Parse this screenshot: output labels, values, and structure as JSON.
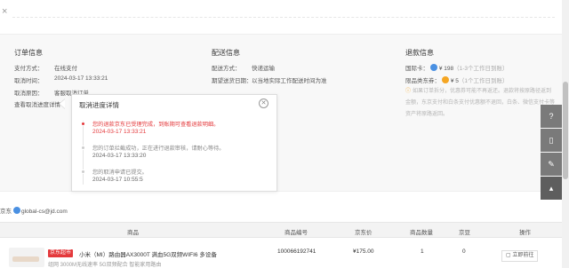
{
  "top": {
    "close_glyph": "×"
  },
  "order_info": {
    "title": "订单信息",
    "rows": [
      {
        "label": "支付方式：",
        "value": "在线支付"
      },
      {
        "label": "取消时间：",
        "value": "2024-03-17 13:33:21"
      },
      {
        "label": "取消原因：",
        "value": "客服取消订单"
      }
    ],
    "progress_link": "查看取消进度详情"
  },
  "delivery_info": {
    "title": "配送信息",
    "rows": [
      {
        "label": "配送方式：",
        "value": "快递运输"
      },
      {
        "label": "期望送货日期：",
        "value": "以当地实际工作配送时间为准"
      }
    ]
  },
  "refund_info": {
    "title": "退款信息",
    "rows": [
      {
        "label": "国际卡：",
        "amount": "¥ 198",
        "note": "（1-3个工作日到账）"
      },
      {
        "label": "限品类东券：",
        "amount": "¥ 5",
        "note": "（1个工作日到账）"
      }
    ],
    "notice": "如果订单拆分，优惠券可能不再返还。退款将按原路径返到金额，东京支付和白条支付优惠额不退回，白条、微信支付卡等资产将原路返回。"
  },
  "popup": {
    "title": "取消进度详情",
    "close_glyph": "✕",
    "steps": [
      {
        "text": "您的退款京东已受理完成，到账期可查看退款明细。",
        "time": "2024-03-17 13:33:21",
        "active": true
      },
      {
        "text": "您的订单拦截成功，正在进行退款审核，请耐心等待。",
        "time": "2024-03-17 13:33:20",
        "active": false
      },
      {
        "text": "您的取消申请已提交。",
        "time": "2024-03-17 10:55:5",
        "active": false
      }
    ]
  },
  "seller": {
    "prefix": "京东",
    "email": "global-cs@jd.com"
  },
  "table": {
    "headers": [
      "商品",
      "商品编号",
      "京东价",
      "商品数量",
      "京豆",
      "操作"
    ],
    "rows": [
      {
        "tag": "京东超市",
        "name": "小米（MI）路由器AX3000T 满血5G双频WIFI6 多设备",
        "name_line2": "组网 3000M无线速率 5G双频配合 智能家用路由",
        "sku": "100066192741",
        "price": "¥175.00",
        "qty": "1",
        "beans": "0"
      }
    ]
  },
  "float_button": "立即前往",
  "side_tools": [
    {
      "icon": "help-icon",
      "glyph": "?"
    },
    {
      "icon": "phone-icon",
      "glyph": "▯"
    },
    {
      "icon": "edit-icon",
      "glyph": "✎"
    },
    {
      "icon": "back-to-top-icon",
      "glyph": "▴"
    }
  ]
}
